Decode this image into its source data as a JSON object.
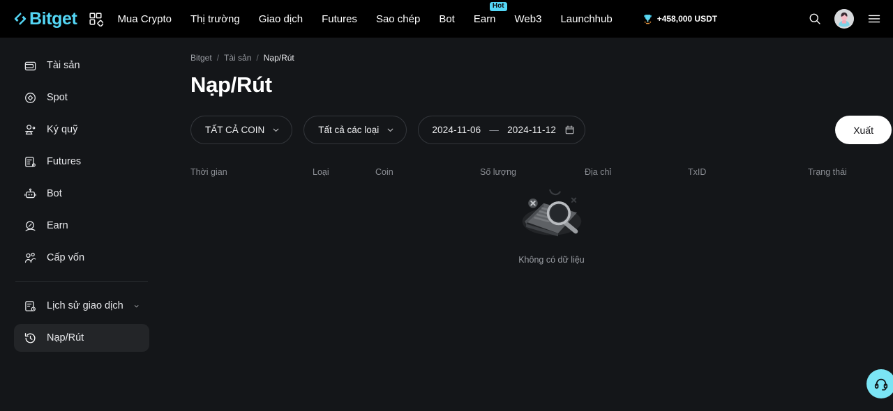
{
  "header": {
    "brand": "Bitget",
    "apps_icon": "grid-apps-icon",
    "nav": [
      {
        "label": "Mua Crypto",
        "badge": null
      },
      {
        "label": "Thị trường",
        "badge": null
      },
      {
        "label": "Giao dịch",
        "badge": null
      },
      {
        "label": "Futures",
        "badge": null
      },
      {
        "label": "Sao chép",
        "badge": null
      },
      {
        "label": "Bot",
        "badge": null
      },
      {
        "label": "Earn",
        "badge": "Hot"
      },
      {
        "label": "Web3",
        "badge": null
      },
      {
        "label": "Launchhub",
        "badge": null
      }
    ],
    "promo": {
      "icon": "trophy-icon",
      "label": "+458,000 USDT"
    },
    "search_icon": "search-icon",
    "avatar": "user-avatar",
    "menu_icon": "hamburger-menu-icon",
    "accent": "#54D6F5"
  },
  "sidebar": {
    "items": [
      {
        "label": "Tài sản",
        "icon": "wallet-icon",
        "active": false
      },
      {
        "label": "Spot",
        "icon": "spot-diamond-icon",
        "active": false
      },
      {
        "label": "Ký quỹ",
        "icon": "margin-scale-icon",
        "active": false
      },
      {
        "label": "Futures",
        "icon": "futures-doc-icon",
        "active": false
      },
      {
        "label": "Bot",
        "icon": "robot-icon",
        "active": false
      },
      {
        "label": "Earn",
        "icon": "earn-coin-icon",
        "active": false
      },
      {
        "label": "Cấp vốn",
        "icon": "funding-people-icon",
        "active": false
      }
    ],
    "group2": [
      {
        "label": "Lịch sử giao dịch",
        "icon": "history-doc-icon",
        "active": false,
        "expandable": true
      },
      {
        "label": "Nạp/Rút",
        "icon": "deposit-withdraw-icon",
        "active": true,
        "expandable": false
      }
    ]
  },
  "main": {
    "breadcrumb": [
      "Bitget",
      "Tài sản",
      "Nạp/Rút"
    ],
    "breadcrumb_sep": "/",
    "title": "Nạp/Rút",
    "filters": {
      "coin": {
        "value": "TẤT CẢ COIN",
        "icon": "chevron-down-icon"
      },
      "type": {
        "value": "Tất cả các loại",
        "icon": "chevron-down-icon"
      },
      "date": {
        "start": "2024-11-06",
        "end": "2024-11-12",
        "dash": "—",
        "icon": "calendar-icon"
      }
    },
    "export_label": "Xuất",
    "table": {
      "columns": [
        "Thời gian",
        "Loại",
        "Coin",
        "Số lượng",
        "Địa chỉ",
        "TxID",
        "Trạng thái"
      ],
      "rows": []
    },
    "empty_state": {
      "illustration": "no-data-document-magnifier-icon",
      "text": "Không có dữ liệu"
    },
    "support_button": {
      "icon": "headset-support-icon",
      "color": "#7BE5F5"
    }
  }
}
